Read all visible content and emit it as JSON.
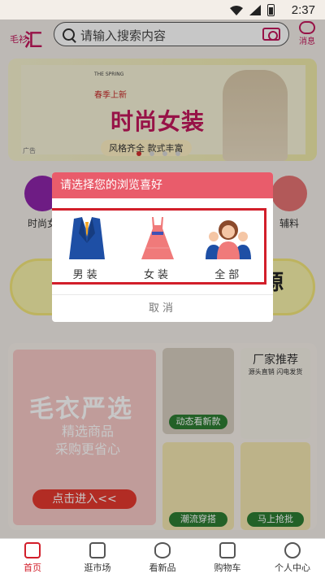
{
  "status": {
    "time": "2:37"
  },
  "header": {
    "logo_small": "毛衫",
    "logo_big": "汇",
    "search_placeholder": "请输入搜索内容",
    "message_label": "消息"
  },
  "banner": {
    "the": "THE SPRING",
    "spring_new": "春季上新",
    "title": "时尚女装",
    "subtitle": "风格齐全 款式丰富",
    "ad": "广告"
  },
  "categories": [
    {
      "label": "时尚女",
      "color": "#8e24aa"
    },
    {
      "label": "辅料",
      "color": "#e57373"
    }
  ],
  "promo": {
    "text": "源"
  },
  "lower": {
    "big_title": "毛衣严选",
    "big_sub_1": "精选商品",
    "big_sub_2": "采购更省心",
    "big_button": "点击进入<<",
    "tile1_label": "动态看新款",
    "tile2_head": "厂家推荐",
    "tile2_sub": "源头直销  闪电发货",
    "tile3_label": "潮流穿搭",
    "tile4_label": "马上抢批"
  },
  "dialog": {
    "title": "请选择您的浏览喜好",
    "options": [
      {
        "label": "男装"
      },
      {
        "label": "女装"
      },
      {
        "label": "全部"
      }
    ],
    "cancel": "取消"
  },
  "nav": [
    {
      "label": "首页",
      "active": true
    },
    {
      "label": "逛市场",
      "active": false
    },
    {
      "label": "看新品",
      "active": false
    },
    {
      "label": "购物车",
      "active": false
    },
    {
      "label": "个人中心",
      "active": false
    }
  ],
  "colors": {
    "accent": "#d21e2a",
    "dialog_header": "#e95c6b"
  }
}
